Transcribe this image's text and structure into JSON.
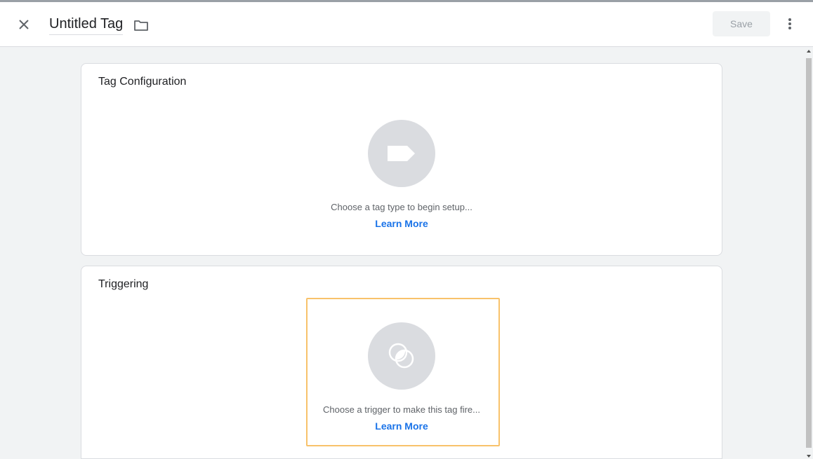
{
  "header": {
    "title": "Untitled Tag",
    "save_label": "Save",
    "close_icon": "close-icon",
    "folder_icon": "folder-icon",
    "more_icon": "more-vert-icon"
  },
  "tag_configuration": {
    "title": "Tag Configuration",
    "hint": "Choose a tag type to begin setup...",
    "learn_more": "Learn More",
    "icon": "tag-icon"
  },
  "triggering": {
    "title": "Triggering",
    "hint": "Choose a trigger to make this tag fire...",
    "learn_more": "Learn More",
    "icon": "trigger-icon"
  },
  "colors": {
    "accent": "#1a73e8",
    "highlight": "#f8c26b",
    "placeholder": "#dadce0"
  }
}
